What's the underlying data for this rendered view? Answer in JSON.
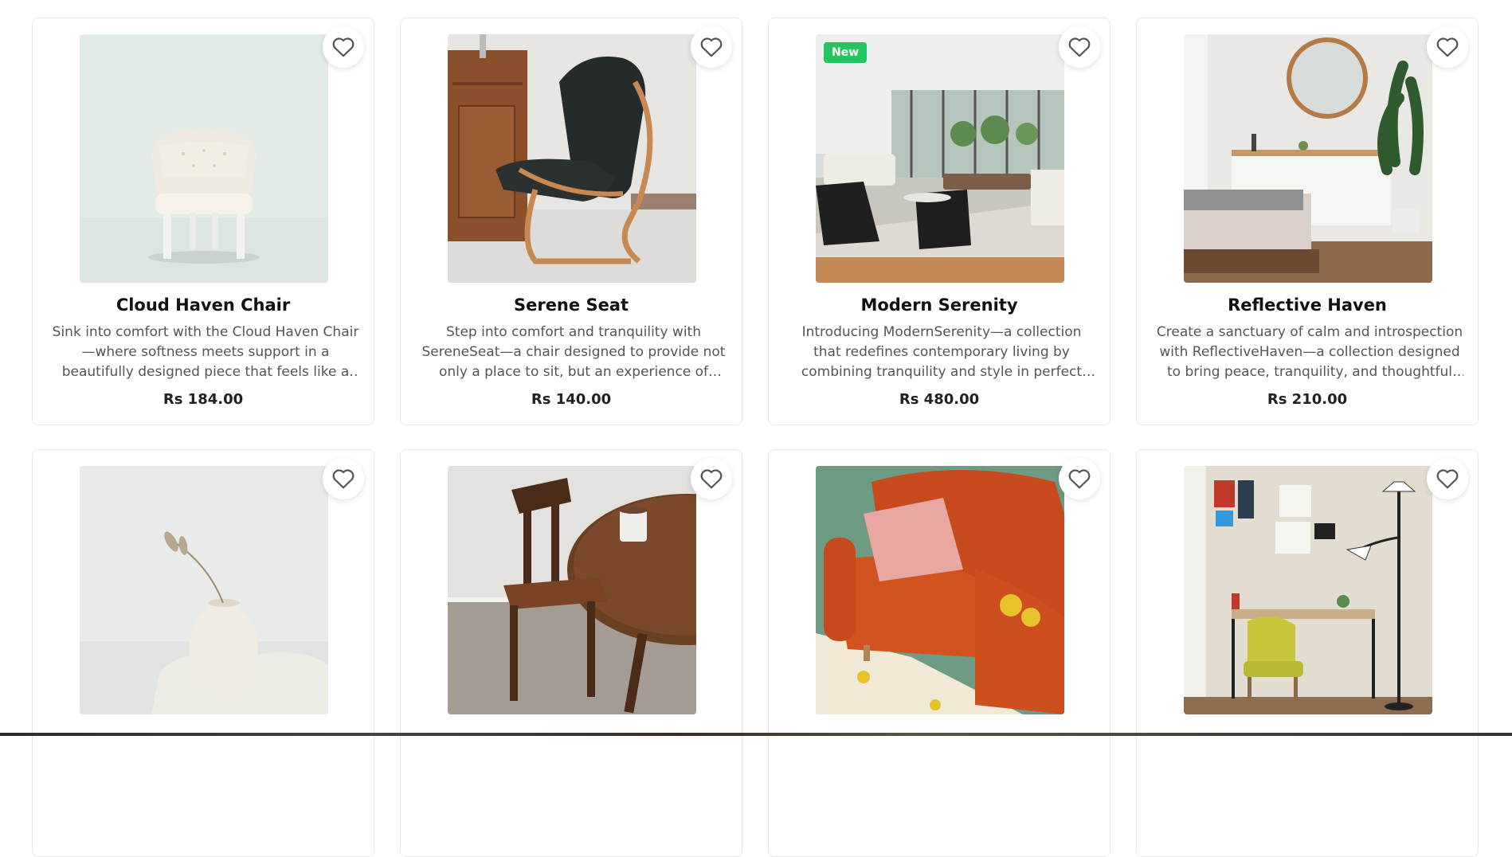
{
  "products": [
    {
      "title": "Cloud Haven Chair",
      "description": "Sink into comfort with the Cloud Haven Chair—where softness meets support in a beautifully designed piece that feels like a personal retreat...",
      "price": "Rs 184.00",
      "badge": "",
      "image_icon": "white-tufted-chair-image"
    },
    {
      "title": "Serene Seat",
      "description": "Step into comfort and tranquility with SereneSeat—a chair designed to provide not only a place to sit, but an experience of relaxation and calm....",
      "price": "Rs 140.00",
      "badge": "",
      "image_icon": "black-lounge-chair-image"
    },
    {
      "title": "Modern Serenity",
      "description": "Introducing ModernSerenity—a collection that redefines contemporary living by combining tranquility and style in perfect harmony. Designe...",
      "price": "Rs 480.00",
      "badge": "New",
      "image_icon": "living-room-image"
    },
    {
      "title": "Reflective Haven",
      "description": "Create a sanctuary of calm and introspection with ReflectiveHaven—a collection designed to bring peace, tranquility, and thoughtful elegance into...",
      "price": "Rs 210.00",
      "badge": "",
      "image_icon": "bedroom-mirror-image"
    },
    {
      "title": "",
      "description": "",
      "price": "",
      "badge": "",
      "image_icon": "ceramic-vase-image"
    },
    {
      "title": "",
      "description": "",
      "price": "",
      "badge": "",
      "image_icon": "wooden-chair-table-image"
    },
    {
      "title": "",
      "description": "",
      "price": "",
      "badge": "",
      "image_icon": "orange-sofa-image"
    },
    {
      "title": "",
      "description": "",
      "price": "",
      "badge": "",
      "image_icon": "yellow-chair-desk-image"
    }
  ],
  "colors": {
    "badge_green": "#22c55e",
    "card_border": "#e5e7eb",
    "text_muted": "#555555"
  },
  "icons": {
    "favorite": "heart-outline-icon"
  }
}
